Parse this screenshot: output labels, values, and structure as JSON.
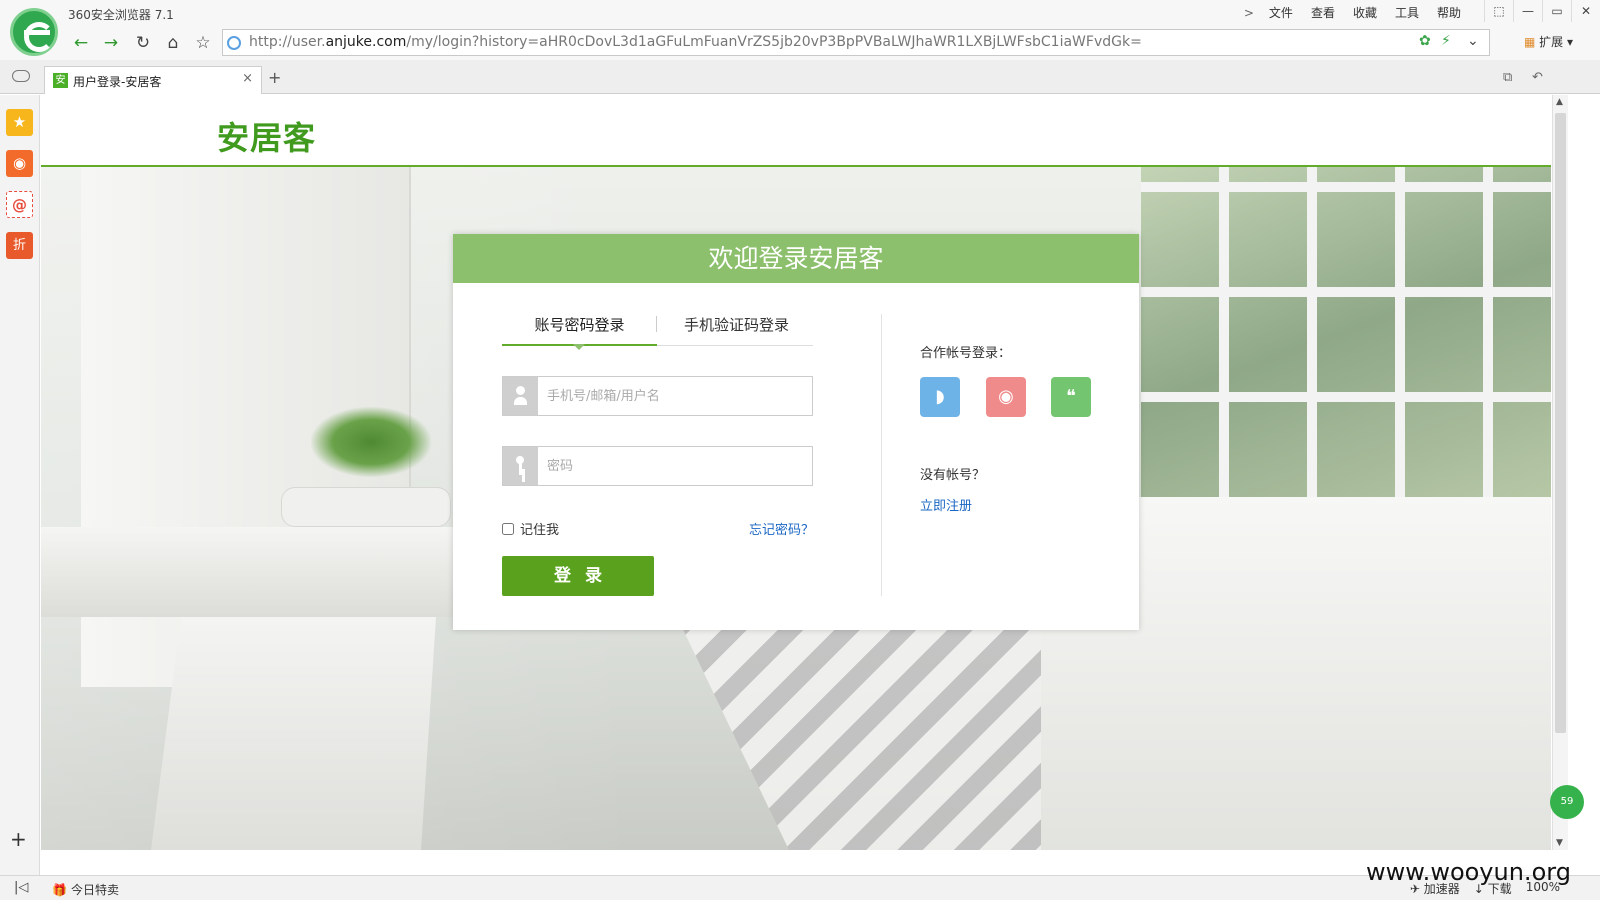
{
  "browser": {
    "app_title": "360安全浏览器 7.1",
    "menu": [
      "文件",
      "查看",
      "收藏",
      "工具",
      "帮助"
    ],
    "menu_chevron": ">",
    "window_controls": [
      "⬚",
      "—",
      "▭",
      "✕"
    ],
    "url_prefix": "http://user.",
    "url_domain": "anjuke.com",
    "url_rest": "/my/login?history=aHR0cDovL3d1aGFuLmFuanVrZS5jb20vP3BpPVBaLWJhaWR1LXBjLWFsbC1iaWFvdGk=",
    "extensions_label": "扩展",
    "tab_title": "用户登录-安居客",
    "tab_favicon": "安",
    "icons": [
      "back-icon",
      "forward-icon",
      "refresh-icon",
      "home-icon",
      "star-icon"
    ]
  },
  "sidebar": {
    "items": [
      "favorites-icon",
      "weibo-icon",
      "mail-icon",
      "discount-icon"
    ],
    "sale_glyph": "折",
    "mail_glyph": "@"
  },
  "site": {
    "logo": "安居客",
    "accent": "#62ab2b"
  },
  "login": {
    "header": "欢迎登录安居客",
    "tab_password": "账号密码登录",
    "tab_sms": "手机验证码登录",
    "username_placeholder": "手机号/邮箱/用户名",
    "password_placeholder": "密码",
    "remember_label": "记住我",
    "forgot_link": "忘记密码？",
    "submit_label": "登录",
    "partner_label": "合作帐号登录：",
    "partners": [
      "qq-icon",
      "weibo-icon",
      "wechat-icon"
    ],
    "no_account": "没有帐号？",
    "register_link": "立即注册"
  },
  "statusbar": {
    "today_deal": "今日特卖",
    "items": [
      "加速器",
      "下载"
    ],
    "zoom": "100%"
  },
  "badge": "59",
  "watermark": "www.wooyun.org"
}
